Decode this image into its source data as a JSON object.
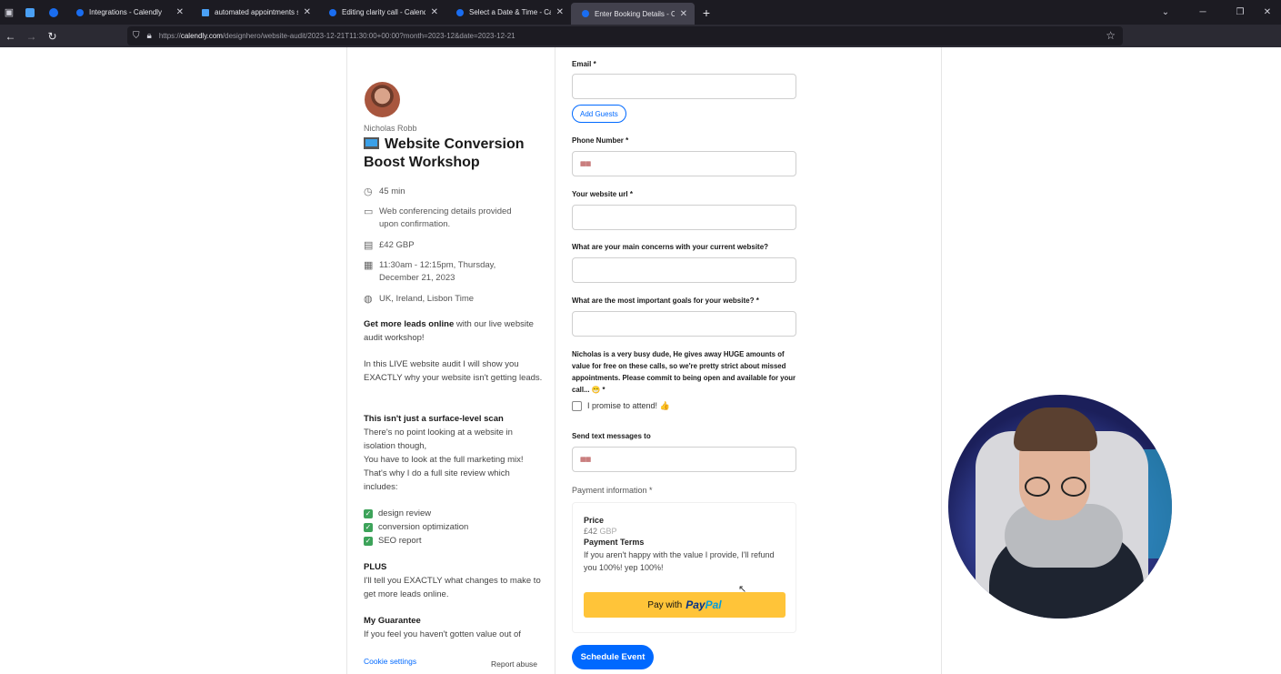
{
  "browser": {
    "tabs": [
      {
        "title": "Integrations - Calendly",
        "active": false
      },
      {
        "title": "automated appointments sche",
        "active": false
      },
      {
        "title": "Editing clarity call - Calendly",
        "active": false
      },
      {
        "title": "Select a Date & Time - Calendly",
        "active": false
      },
      {
        "title": "Enter Booking Details - Calendly",
        "active": true
      }
    ],
    "url_prefix": "https://",
    "url_domain": "calendly.com",
    "url_path": "/designhero/website-audit/2023-12-21T11:30:00+00:00?month=2023-12&date=2023-12-21"
  },
  "event": {
    "host": "Nicholas Robb",
    "title": "Website Conversion Boost Workshop",
    "duration": "45 min",
    "conferencing": "Web conferencing details provided upon confirmation.",
    "price": "£42 GBP",
    "datetime": "11:30am - 12:15pm, Thursday, December 21, 2023",
    "timezone": "UK, Ireland, Lisbon Time"
  },
  "description": {
    "p1_bold": "Get more leads online",
    "p1_rest": " with our live website audit workshop!",
    "p2": "In this LIVE website audit I will show you EXACTLY why your website isn't getting leads.",
    "h2": "This isn't just a surface-level scan",
    "p3a": "There's no point looking at a website in isolation though,",
    "p3b": "You have to look at the full marketing mix!",
    "p3c": "That's why I do a full site review which includes:",
    "checklist": [
      "design review",
      "conversion optimization",
      "SEO report"
    ],
    "h3": "PLUS",
    "p4": "I'll tell you EXACTLY what changes to make to get more leads online.",
    "h4": "My Guarantee",
    "p5": "If you feel you haven't gotten value out of"
  },
  "footer": {
    "cookie": "Cookie settings",
    "report": "Report abuse"
  },
  "form": {
    "email_label": "Email *",
    "add_guests": "Add Guests",
    "phone_label": "Phone Number *",
    "website_label": "Your website url *",
    "concerns_label": "What are your main concerns with your current website?",
    "goals_label": "What are the most important goals for your website? *",
    "note": "Nicholas is a very busy dude, He gives away HUGE amounts of value for free on these calls, so we're pretty strict about missed appointments. Please commit to being open and available for your call... 😁 *",
    "promise": "I promise to attend! 👍",
    "sms_label": "Send text messages to",
    "payment_label": "Payment information *",
    "price_h": "Price",
    "price_v": "£42",
    "price_cur": "GBP",
    "terms_h": "Payment Terms",
    "terms_v": "If you aren't happy with the value I provide, I'll refund you 100%! yep 100%!",
    "paypal_prefix": "Pay with",
    "paypal_p1": "Pay",
    "paypal_p2": "Pal",
    "schedule": "Schedule Event"
  }
}
